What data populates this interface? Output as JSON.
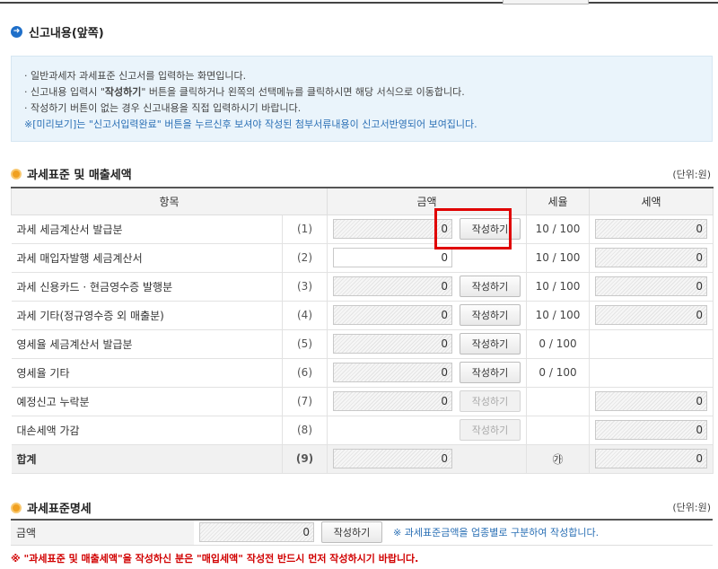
{
  "section1": {
    "title": "신고내용(앞쪽)"
  },
  "notice": {
    "line1": "· 일반과세자 과세표준 신고서를 입력하는 화면입니다.",
    "line2_pre": "· 신고내용 입력시 \"",
    "line2_bold": "작성하기",
    "line2_post": "\" 버튼을 클릭하거나 왼쪽의 선택메뉴를 클릭하시면 해당 서식으로 이동합니다.",
    "line3": "· 작성하기 버튼이 없는 경우 신고내용을 직접 입력하시기 바랍니다.",
    "line4": "※[미리보기]는 \"신고서입력완료\" 버튼을 누르신후 보셔야 작성된 첨부서류내용이 신고서반영되어 보여집니다."
  },
  "section2": {
    "title": "과세표준 및 매출세액",
    "unit": "(단위:원)"
  },
  "table": {
    "headers": {
      "item": "항목",
      "amount": "금액",
      "rate": "세율",
      "tax": "세액"
    },
    "write_label": "작성하기",
    "rows": [
      {
        "label": "과세 세금계산서 발급분",
        "num": "(1)",
        "amount": "0",
        "rate": "10 / 100",
        "tax": "0"
      },
      {
        "label": "과세 매입자발행 세금계산서",
        "num": "(2)",
        "amount": "0",
        "rate": "10 / 100",
        "tax": "0"
      },
      {
        "label": "과세 신용카드 · 현금영수증 발행분",
        "num": "(3)",
        "amount": "0",
        "rate": "10 / 100",
        "tax": "0"
      },
      {
        "label": "과세 기타(정규영수증 외 매출분)",
        "num": "(4)",
        "amount": "0",
        "rate": "10 / 100",
        "tax": "0"
      },
      {
        "label": "영세율 세금계산서 발급분",
        "num": "(5)",
        "amount": "0",
        "rate": "0 / 100",
        "tax": ""
      },
      {
        "label": "영세율 기타",
        "num": "(6)",
        "amount": "0",
        "rate": "0 / 100",
        "tax": ""
      },
      {
        "label": "예정신고 누락분",
        "num": "(7)",
        "amount": "0",
        "rate": "",
        "tax": "0"
      },
      {
        "label": "대손세액 가감",
        "num": "(8)",
        "amount": "",
        "rate": "",
        "tax": "0"
      }
    ],
    "total": {
      "label": "합계",
      "num": "(9)",
      "amount": "0",
      "rate": "㉮",
      "tax": "0"
    }
  },
  "section3": {
    "title": "과세표준명세",
    "unit": "(단위:원)"
  },
  "table2": {
    "label": "금액",
    "amount": "0",
    "button": "작성하기",
    "note": "※ 과세표준금액을 업종별로 구분하여 작성합니다."
  },
  "warning": "※ \"과세표준 및 매출세액\"을 작성하신 분은 \"매입세액\" 작성전 반드시 먼저 작성하시기 바랍니다."
}
